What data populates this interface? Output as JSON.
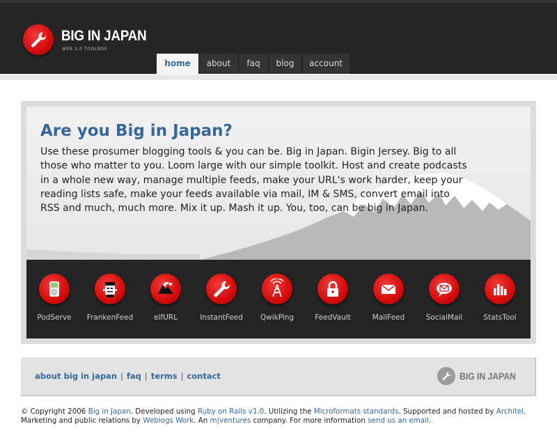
{
  "brand": {
    "title": "BIG IN JAPAN",
    "tagline": "WEB 2.0 TOOLBOX",
    "logo_icon": "wrench-icon",
    "accent_color": "#d30b0b",
    "link_color": "#37679a"
  },
  "nav": {
    "tabs": [
      {
        "label": "home",
        "active": true
      },
      {
        "label": "about",
        "active": false
      },
      {
        "label": "faq",
        "active": false
      },
      {
        "label": "blog",
        "active": false
      },
      {
        "label": "account",
        "active": false
      }
    ]
  },
  "hero": {
    "title": "Are you Big in Japan?",
    "body": "Use these prosumer blogging tools & you can be. Big in Japan. Bigin Jersey. Big to all those who matter to you. Loom large with our simple toolkit. Host and create podcasts in a whole new way, manage multiple feeds, make your URL's work harder, keep your reading lists safe, make your feeds available via mail, IM & SMS, convert email into RSS and much, much more. Mix it up. Mash it up. You, too, can be big in Japan."
  },
  "tools": [
    {
      "label": "PodServe",
      "icon": "ipod-icon"
    },
    {
      "label": "FrankenFeed",
      "icon": "frankenstein-icon"
    },
    {
      "label": "elfURL",
      "icon": "elf-hat-icon"
    },
    {
      "label": "InstantFeed",
      "icon": "wrench-icon"
    },
    {
      "label": "QwikPing",
      "icon": "antenna-icon"
    },
    {
      "label": "FeedVault",
      "icon": "padlock-icon"
    },
    {
      "label": "MailFeed",
      "icon": "envelope-icon"
    },
    {
      "label": "SocialMail",
      "icon": "chat-envelope-icon"
    },
    {
      "label": "StatsTool",
      "icon": "bar-chart-icon"
    }
  ],
  "footer": {
    "links": [
      "about big in japan",
      "faq",
      "terms",
      "contact"
    ],
    "separator": "|",
    "logo_text": "BIG IN JAPAN"
  },
  "copyright": {
    "t1": "© Copyright 2006 ",
    "l1": "Big in Japan",
    "t2": ". Developed using ",
    "l2": "Ruby on Rails v1.0",
    "t3": ". Utilizing the ",
    "l3": "Microformats standards",
    "t4": ". Supported and hosted by ",
    "l4": "Architel",
    "t5": ". Marketing and public relations by ",
    "l5": "Weblogs Work",
    "t6": ". An ",
    "l6": "m|ventures",
    "t7": " company. For more information ",
    "l7": "send us an email",
    "t8": "."
  }
}
